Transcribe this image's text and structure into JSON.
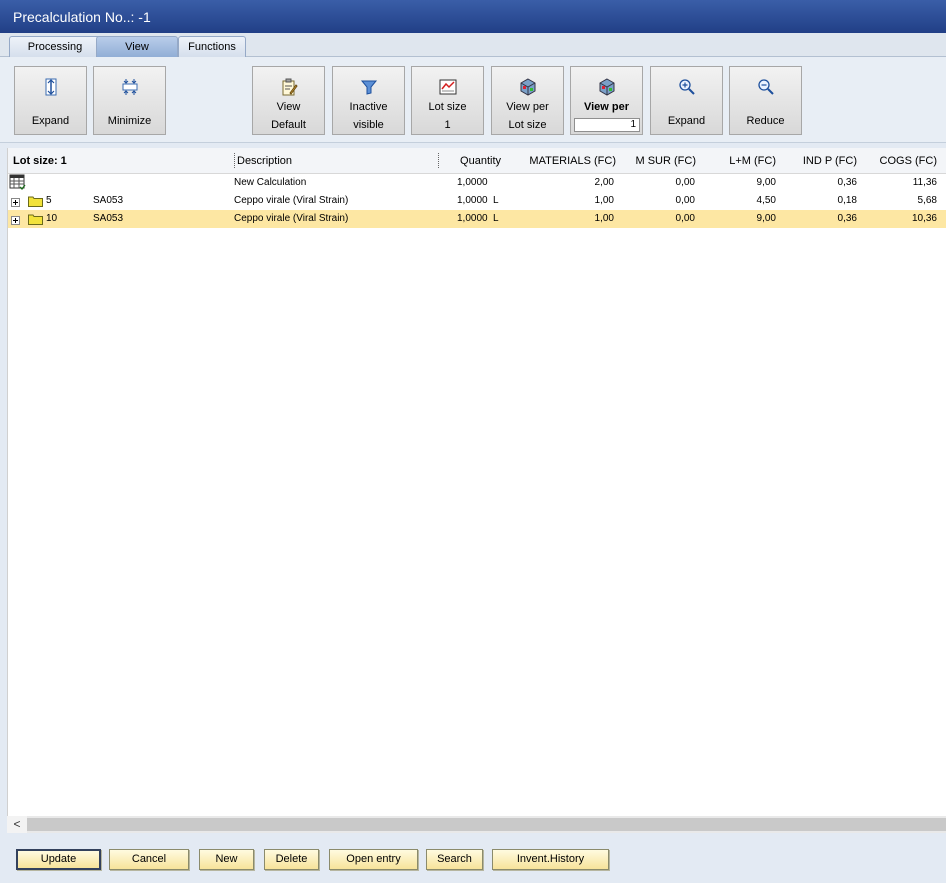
{
  "window": {
    "title": "Precalculation No..: -1"
  },
  "tabs": [
    {
      "label": "Processing"
    },
    {
      "label": "View",
      "active": true
    },
    {
      "label": "Functions"
    }
  ],
  "toolbar": {
    "expand_tree": {
      "label": "Expand"
    },
    "minimize": {
      "label": "Minimize"
    },
    "view_default": {
      "line1": "View",
      "line2": "Default"
    },
    "inactive_visible": {
      "line1": "Inactive",
      "line2": "visible"
    },
    "lot_size": {
      "line1": "Lot size",
      "line2": "1"
    },
    "view_per_lot_size": {
      "line1": "View per",
      "line2": "Lot size"
    },
    "view_per": {
      "label": "View per",
      "value": "1"
    },
    "expand_zoom": {
      "label": "Expand"
    },
    "reduce": {
      "label": "Reduce"
    }
  },
  "grid": {
    "lot_size_label": "Lot size: 1",
    "columns": [
      "Description",
      "Quantity",
      "MATERIALS (FC)",
      "M SUR (FC)",
      "L+M (FC)",
      "IND P (FC)",
      "COGS (FC)"
    ],
    "rows": [
      {
        "level": "",
        "code": "",
        "description": "New Calculation",
        "quantity": "1,0000",
        "unit": "",
        "materials": "2,00",
        "msur": "0,00",
        "lm": "9,00",
        "indp": "0,36",
        "cogs": "11,36"
      },
      {
        "level": "5",
        "code": "SA053",
        "description": "Ceppo virale (Viral Strain)",
        "quantity": "1,0000",
        "unit": "L",
        "materials": "1,00",
        "msur": "0,00",
        "lm": "4,50",
        "indp": "0,18",
        "cogs": "5,68"
      },
      {
        "level": "10",
        "code": "SA053",
        "description": "Ceppo virale (Viral Strain)",
        "quantity": "1,0000",
        "unit": "L",
        "materials": "1,00",
        "msur": "0,00",
        "lm": "9,00",
        "indp": "0,36",
        "cogs": "10,36"
      }
    ]
  },
  "scrollbar": {
    "left_arrow": "<"
  },
  "footer": {
    "update": "Update",
    "cancel": "Cancel",
    "new": "New",
    "delete": "Delete",
    "open_entry": "Open entry",
    "search": "Search",
    "invent_history": "Invent.History"
  },
  "colors": {
    "title_bar": "#213f86",
    "selected_row": "#fde7a3",
    "footer_button": "#f7e39a"
  }
}
